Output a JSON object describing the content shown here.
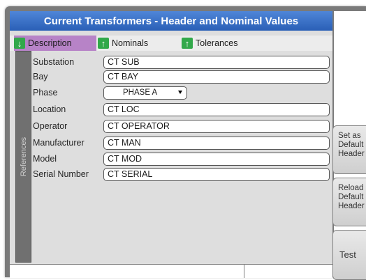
{
  "window": {
    "title": "Current Transformers - Header and Nominal Values"
  },
  "tabs": [
    {
      "label": "Description",
      "active": true
    },
    {
      "label": "Nominals",
      "active": false
    },
    {
      "label": "Tolerances",
      "active": false
    }
  ],
  "sidebar": {
    "label": "References"
  },
  "fields": [
    {
      "label": "Substation",
      "value": "CT SUB"
    },
    {
      "label": "Bay",
      "value": "CT BAY"
    },
    {
      "label": "Phase",
      "value": "PHASE A"
    },
    {
      "label": "Location",
      "value": "CT LOC"
    },
    {
      "label": "Operator",
      "value": "CT OPERATOR"
    },
    {
      "label": "Manufacturer",
      "value": "CT MAN"
    },
    {
      "label": "Model",
      "value": "CT MOD"
    },
    {
      "label": "Serial Number",
      "value": "CT SERIAL"
    }
  ],
  "buttons": {
    "set_default": [
      "Set as",
      "Default",
      "Header"
    ],
    "reload_default": [
      "Reload",
      "Default",
      "Header"
    ],
    "test": "Test"
  },
  "colors": {
    "title_bar": "#3a70c8",
    "active_tab": "#b783c7",
    "tab_arrow": "#32a84a",
    "sidebar": "#707070"
  },
  "icons": {
    "description_tab": "arrow-down-icon",
    "nominals_tab": "arrow-up-icon",
    "tolerances_tab": "arrow-up-icon",
    "phase_select": "chevron-down-icon"
  }
}
